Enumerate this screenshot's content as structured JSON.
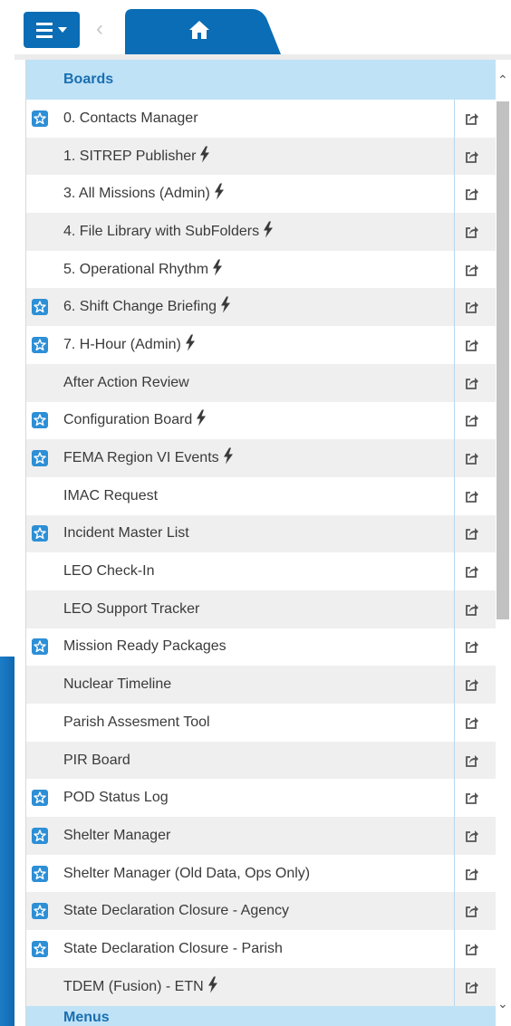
{
  "section_boards": "Boards",
  "section_menus": "Menus",
  "colors": {
    "accent": "#0a6db5",
    "section_bg": "#bfe2f7",
    "favorite": "#2d8fd6"
  },
  "boards": [
    {
      "label": "0. Contacts Manager",
      "favorite": true,
      "bolt": false
    },
    {
      "label": "1. SITREP Publisher",
      "favorite": false,
      "bolt": true
    },
    {
      "label": "3. All Missions (Admin)",
      "favorite": false,
      "bolt": true
    },
    {
      "label": "4. File Library with SubFolders",
      "favorite": false,
      "bolt": true
    },
    {
      "label": "5. Operational Rhythm",
      "favorite": false,
      "bolt": true
    },
    {
      "label": "6. Shift Change Briefing",
      "favorite": true,
      "bolt": true
    },
    {
      "label": "7. H-Hour (Admin)",
      "favorite": true,
      "bolt": true
    },
    {
      "label": "After Action Review",
      "favorite": false,
      "bolt": false
    },
    {
      "label": "Configuration Board",
      "favorite": true,
      "bolt": true
    },
    {
      "label": "FEMA Region VI Events",
      "favorite": true,
      "bolt": true
    },
    {
      "label": "IMAC Request",
      "favorite": false,
      "bolt": false
    },
    {
      "label": "Incident Master List",
      "favorite": true,
      "bolt": false
    },
    {
      "label": "LEO Check-In",
      "favorite": false,
      "bolt": false
    },
    {
      "label": "LEO Support Tracker",
      "favorite": false,
      "bolt": false
    },
    {
      "label": "Mission Ready Packages",
      "favorite": true,
      "bolt": false
    },
    {
      "label": "Nuclear Timeline",
      "favorite": false,
      "bolt": false
    },
    {
      "label": "Parish Assesment Tool",
      "favorite": false,
      "bolt": false
    },
    {
      "label": "PIR Board",
      "favorite": false,
      "bolt": false
    },
    {
      "label": "POD Status Log",
      "favorite": true,
      "bolt": false
    },
    {
      "label": "Shelter Manager",
      "favorite": true,
      "bolt": false
    },
    {
      "label": "Shelter Manager (Old Data, Ops Only)",
      "favorite": true,
      "bolt": false
    },
    {
      "label": "State Declaration Closure - Agency",
      "favorite": true,
      "bolt": false
    },
    {
      "label": "State Declaration Closure - Parish",
      "favorite": true,
      "bolt": false
    },
    {
      "label": "TDEM (Fusion) - ETN",
      "favorite": false,
      "bolt": true
    }
  ]
}
